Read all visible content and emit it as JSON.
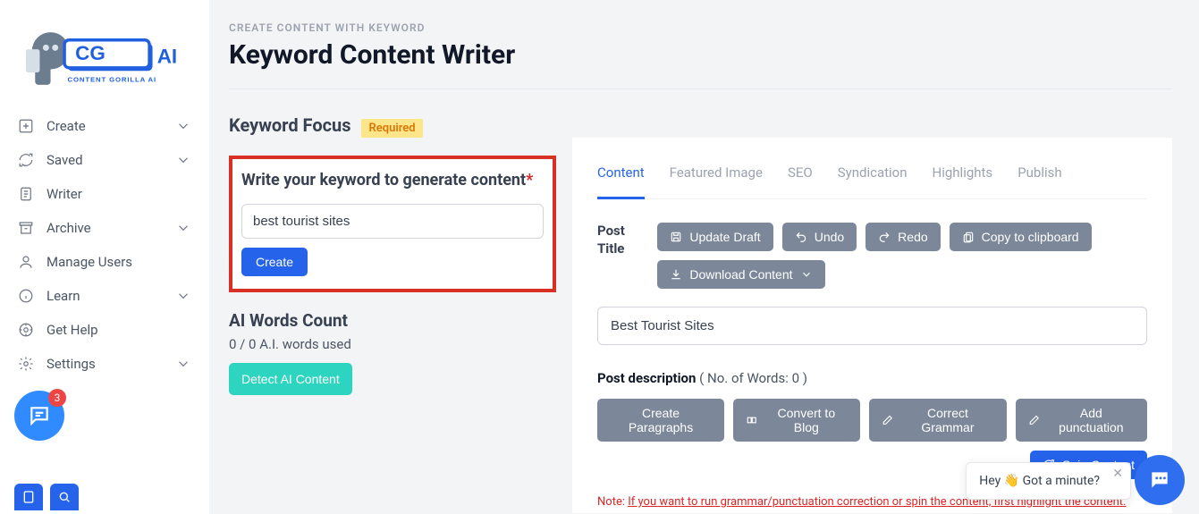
{
  "brand": {
    "name": "CONTENT GORILLA AI",
    "initials": "CG",
    "ai": "AI"
  },
  "sidebar": {
    "items": [
      {
        "label": "Create"
      },
      {
        "label": "Saved"
      },
      {
        "label": "Writer"
      },
      {
        "label": "Archive"
      },
      {
        "label": "Manage Users"
      },
      {
        "label": "Learn"
      },
      {
        "label": "Get Help"
      },
      {
        "label": "Settings"
      }
    ]
  },
  "header": {
    "eyebrow": "CREATE CONTENT WITH KEYWORD",
    "title": "Keyword Content Writer"
  },
  "keywordFocus": {
    "section_label": "Keyword Focus",
    "required": "Required",
    "prompt": "Write your keyword to generate content",
    "input_value": "best tourist sites",
    "button": "Create"
  },
  "aiWords": {
    "title": "AI Words Count",
    "sub": "0 / 0 A.I. words used",
    "detect": "Detect AI Content"
  },
  "tabs": [
    "Content",
    "Featured Image",
    "SEO",
    "Syndication",
    "Highlights",
    "Publish"
  ],
  "post": {
    "title_label": "Post Title",
    "actions": {
      "update": "Update Draft",
      "undo": "Undo",
      "redo": "Redo",
      "copy": "Copy to clipboard",
      "download": "Download Content"
    },
    "title_value": "Best Tourist Sites",
    "desc_label": "Post description",
    "desc_count_label": "( No. of Words: 0 )",
    "actions2": {
      "para": "Create Paragraphs",
      "blog": "Convert to Blog",
      "grammar": "Correct Grammar",
      "punct": "Add punctuation",
      "spin": "Spin Content"
    },
    "note_prefix": "Note: ",
    "note_link": "If you want to run grammar/punctuation correction or spin the content, first highlight the content."
  },
  "chat": {
    "badge": "3",
    "toast": "Hey 👋 Got a minute?"
  }
}
